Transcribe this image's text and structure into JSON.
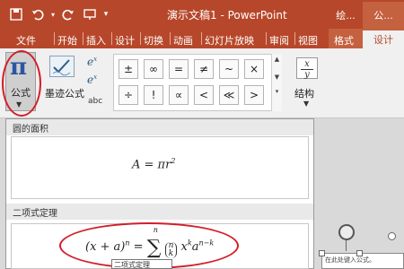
{
  "app": {
    "window_title": "演示文稿1 - PowerPoint",
    "contextual_top_left": "绘...",
    "contextual_top_right": "公..."
  },
  "quick_access": {
    "save_icon": "save-icon",
    "undo_icon": "undo-icon",
    "redo_icon": "redo-icon",
    "slideshow_icon": "slideshow-icon",
    "customize_icon": "chevron-down-icon"
  },
  "tabs": [
    "文件",
    "开始",
    "插入",
    "设计",
    "切换",
    "动画",
    "幻灯片放映",
    "审阅",
    "视图",
    "格式",
    "设计"
  ],
  "active_tab": "设计",
  "ribbon": {
    "formula_label": "公式",
    "ink_formula_label": "墨迹公式",
    "abc_label": "abc",
    "structure_label": "结构",
    "structure_icon_top": "x",
    "structure_icon_bottom": "y",
    "symbols": [
      [
        "±",
        "∞",
        "=",
        "≠",
        "~",
        "×"
      ],
      [
        "÷",
        "!",
        "∝",
        "<",
        "≪",
        ">"
      ]
    ]
  },
  "gallery": {
    "sections": [
      {
        "heading": "圆的面积",
        "formula": "A = πr²"
      },
      {
        "heading": "二项式定理",
        "formula": "(x + a)ⁿ = Σ (n k) xᵏ aⁿ⁻ᵏ"
      }
    ],
    "tooltip": "二项式定理"
  },
  "slide": {
    "formula_box_label": "在此处键入公式。"
  },
  "colors": {
    "ribbon_accent": "#b7472a",
    "highlight_red": "#d21f2a",
    "pi_blue": "#2b56a3"
  }
}
